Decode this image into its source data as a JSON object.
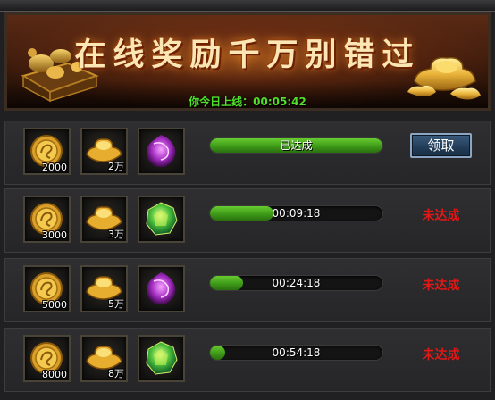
{
  "banner": {
    "title": "在线奖励千万别错过",
    "online_text": "你今日上线：00:05:42"
  },
  "rows": [
    {
      "items": [
        {
          "icon": "gold-coin-icon",
          "qty": "2000"
        },
        {
          "icon": "gold-ingot-icon",
          "qty": "2万"
        },
        {
          "icon": "purple-dragon-gem-icon",
          "qty": ""
        }
      ],
      "progress": 1.0,
      "bar_text": "已达成",
      "action": {
        "type": "button",
        "label": "领取"
      }
    },
    {
      "items": [
        {
          "icon": "gold-coin-icon",
          "qty": "3000"
        },
        {
          "icon": "gold-ingot-icon",
          "qty": "3万"
        },
        {
          "icon": "green-gem-icon",
          "qty": ""
        }
      ],
      "progress": 0.37,
      "bar_text": "00:09:18",
      "action": {
        "type": "status",
        "label": "未达成"
      }
    },
    {
      "items": [
        {
          "icon": "gold-coin-icon",
          "qty": "5000"
        },
        {
          "icon": "gold-ingot-icon",
          "qty": "5万"
        },
        {
          "icon": "purple-dragon-gem-icon",
          "qty": ""
        }
      ],
      "progress": 0.19,
      "bar_text": "00:24:18",
      "action": {
        "type": "status",
        "label": "未达成"
      }
    },
    {
      "items": [
        {
          "icon": "gold-coin-icon",
          "qty": "8000"
        },
        {
          "icon": "gold-ingot-icon",
          "qty": "8万"
        },
        {
          "icon": "green-gem-icon",
          "qty": ""
        }
      ],
      "progress": 0.09,
      "bar_text": "00:54:18",
      "action": {
        "type": "status",
        "label": "未达成"
      }
    }
  ],
  "colors": {
    "progress_green": "#4fae1f",
    "not_reached_red": "#e01818",
    "online_green": "#4ee02a",
    "title_cream": "#fbe6b4"
  }
}
